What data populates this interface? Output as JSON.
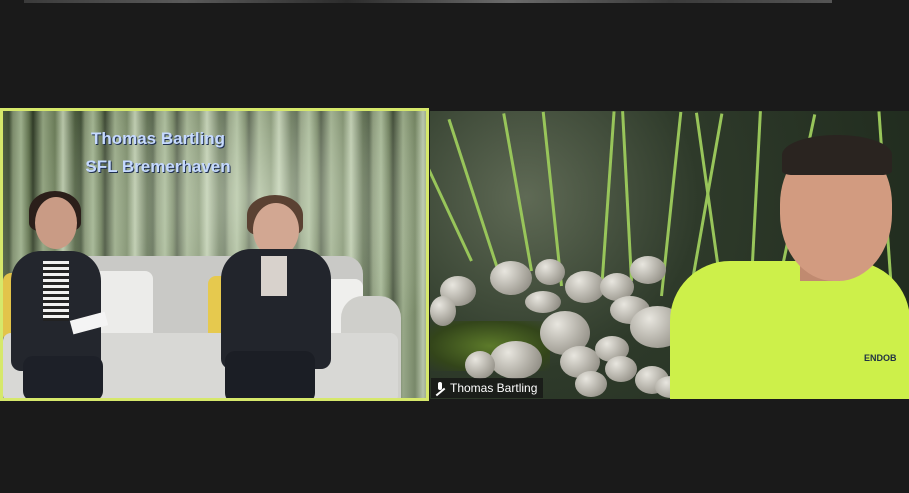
{
  "app": "video-conference",
  "tiles": [
    {
      "overlay_line1": "Thomas Bartling",
      "overlay_line2": "SFL Bremerhaven",
      "active_speaker": true,
      "active_border_color": "#d6e86b"
    },
    {
      "participant_name": "Thomas Bartling",
      "muted_icon": "mic-muted-icon",
      "shirt_text": "ENDOB"
    }
  ],
  "colors": {
    "background": "#1a1a1a",
    "overlay_text": "#c5d9ff"
  }
}
